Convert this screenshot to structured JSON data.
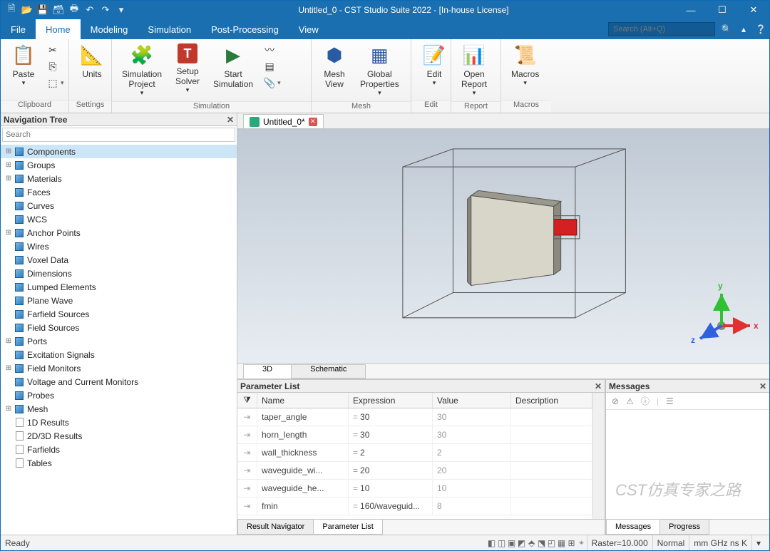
{
  "title": "Untitled_0 - CST Studio Suite 2022 - [In-house License]",
  "qat": {
    "new": "new-icon",
    "open": "open-icon",
    "save": "save-icon",
    "saveall": "save-all-icon",
    "print": "print-icon",
    "undo": "undo-icon",
    "redo": "redo-icon",
    "moredd": "▾"
  },
  "search_placeholder": "Search (Alt+Q)",
  "menus": [
    "File",
    "Home",
    "Modeling",
    "Simulation",
    "Post-Processing",
    "View"
  ],
  "active_menu": "Home",
  "ribbon": {
    "clipboard": {
      "label": "Clipboard",
      "paste": "Paste"
    },
    "settings": {
      "label": "Settings",
      "units": "Units"
    },
    "simulation": {
      "label": "Simulation",
      "simproj": "Simulation\nProject",
      "setup": "Setup\nSolver",
      "start": "Start\nSimulation"
    },
    "mesh": {
      "label": "Mesh",
      "meshview": "Mesh\nView",
      "global": "Global\nProperties"
    },
    "edit": {
      "label": "Edit",
      "edit": "Edit"
    },
    "report": {
      "label": "Report",
      "open": "Open\nReport"
    },
    "macros": {
      "label": "Macros",
      "macros": "Macros"
    }
  },
  "nav": {
    "title": "Navigation Tree",
    "search_placeholder": "Search",
    "items": [
      {
        "label": "Components",
        "exp": "⊞",
        "sel": true,
        "ic": "cube"
      },
      {
        "label": "Groups",
        "exp": "⊞",
        "ic": "cube"
      },
      {
        "label": "Materials",
        "exp": "⊞",
        "ic": "cube"
      },
      {
        "label": "Faces",
        "exp": "",
        "ic": "cube"
      },
      {
        "label": "Curves",
        "exp": "",
        "ic": "cube"
      },
      {
        "label": "WCS",
        "exp": "",
        "ic": "cube"
      },
      {
        "label": "Anchor Points",
        "exp": "⊞",
        "ic": "cube"
      },
      {
        "label": "Wires",
        "exp": "",
        "ic": "cube"
      },
      {
        "label": "Voxel Data",
        "exp": "",
        "ic": "cube"
      },
      {
        "label": "Dimensions",
        "exp": "",
        "ic": "cube"
      },
      {
        "label": "Lumped Elements",
        "exp": "",
        "ic": "cube"
      },
      {
        "label": "Plane Wave",
        "exp": "",
        "ic": "cube"
      },
      {
        "label": "Farfield Sources",
        "exp": "",
        "ic": "cube"
      },
      {
        "label": "Field Sources",
        "exp": "",
        "ic": "cube"
      },
      {
        "label": "Ports",
        "exp": "⊞",
        "ic": "cube"
      },
      {
        "label": "Excitation Signals",
        "exp": "",
        "ic": "cube"
      },
      {
        "label": "Field Monitors",
        "exp": "⊞",
        "ic": "cube"
      },
      {
        "label": "Voltage and Current Monitors",
        "exp": "",
        "ic": "cube"
      },
      {
        "label": "Probes",
        "exp": "",
        "ic": "cube"
      },
      {
        "label": "Mesh",
        "exp": "⊞",
        "ic": "cube"
      },
      {
        "label": "1D Results",
        "exp": "",
        "ic": "page"
      },
      {
        "label": "2D/3D Results",
        "exp": "",
        "ic": "page"
      },
      {
        "label": "Farfields",
        "exp": "",
        "ic": "page"
      },
      {
        "label": "Tables",
        "exp": "",
        "ic": "page"
      }
    ]
  },
  "doc_tab": "Untitled_0*",
  "view_tabs": {
    "t3d": "3D",
    "schem": "Schematic"
  },
  "param_panel": {
    "title": "Parameter List",
    "cols": {
      "name": "Name",
      "expr": "Expression",
      "val": "Value",
      "desc": "Description"
    },
    "rows": [
      {
        "name": "taper_angle",
        "expr": "30",
        "val": "30"
      },
      {
        "name": "horn_length",
        "expr": "30",
        "val": "30"
      },
      {
        "name": "wall_thickness",
        "expr": "2",
        "val": "2"
      },
      {
        "name": "waveguide_wi...",
        "expr": "20",
        "val": "20"
      },
      {
        "name": "waveguide_he...",
        "expr": "10",
        "val": "10"
      },
      {
        "name": "fmin",
        "expr": "160/waveguid...",
        "val": "8"
      }
    ],
    "tabs": {
      "resnav": "Result Navigator",
      "plist": "Parameter List"
    }
  },
  "messages": {
    "title": "Messages",
    "tabs": {
      "msg": "Messages",
      "prog": "Progress"
    }
  },
  "status": {
    "ready": "Ready",
    "raster": "Raster=10.000",
    "normal": "Normal",
    "units": "mm  GHz  ns  K"
  },
  "watermark": "CST仿真专家之路"
}
